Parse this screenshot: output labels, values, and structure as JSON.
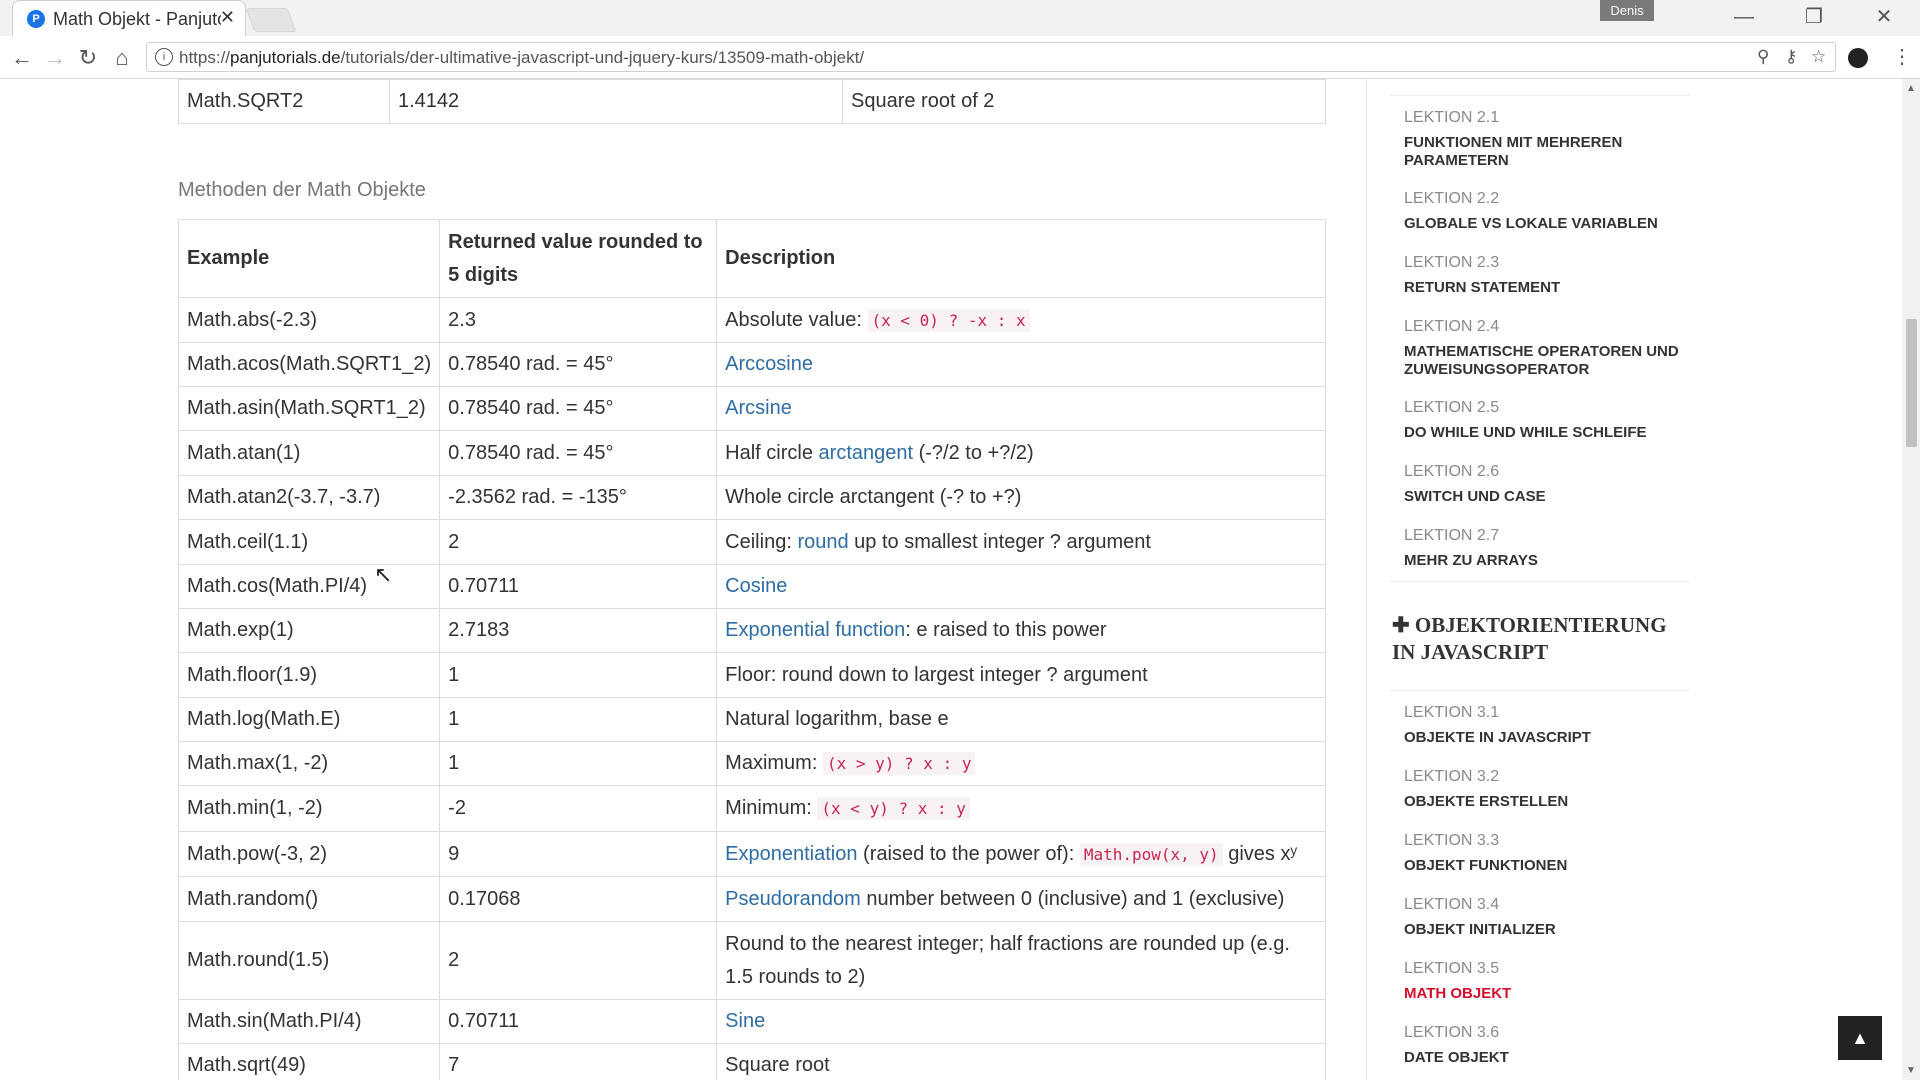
{
  "browser": {
    "tab_title": "Math Objekt - Panjutorials",
    "favicon_letter": "P",
    "close_glyph": "✕",
    "user_badge": "Denis",
    "url_prefix": "https://",
    "url_host": "panjutorials.de",
    "url_path": "/tutorials/der-ultimative-javascript-und-jquery-kurs/13509-math-objekt/"
  },
  "constants_table": {
    "last_row": [
      "Math.SQRT2",
      "1.4142",
      "Square root of 2"
    ]
  },
  "methods_section_title": "Methoden der Math Objekte",
  "methods_table": {
    "headers": [
      "Example",
      "Returned value rounded to 5 digits",
      "Description"
    ],
    "rows": [
      {
        "example": "Math.abs(-2.3)",
        "value": "2.3",
        "pre": "Absolute value: ",
        "link": "",
        "post": "",
        "code": "(x < 0) ? -x : x",
        "after": ""
      },
      {
        "example": "Math.acos(Math.SQRT1_2)",
        "value": "0.78540 rad. = 45°",
        "pre": "",
        "link": "Arccosine",
        "post": "",
        "code": "",
        "after": ""
      },
      {
        "example": "Math.asin(Math.SQRT1_2)",
        "value": "0.78540 rad. = 45°",
        "pre": "",
        "link": "Arcsine",
        "post": "",
        "code": "",
        "after": ""
      },
      {
        "example": "Math.atan(1)",
        "value": "0.78540 rad. = 45°",
        "pre": "Half circle ",
        "link": "arctangent",
        "post": " (-?/2 to +?/2)",
        "code": "",
        "after": ""
      },
      {
        "example": "Math.atan2(-3.7, -3.7)",
        "value": "-2.3562 rad. = -135°",
        "pre": "Whole circle arctangent (-? to +?)",
        "link": "",
        "post": "",
        "code": "",
        "after": ""
      },
      {
        "example": "Math.ceil(1.1)",
        "value": "2",
        "pre": "Ceiling: ",
        "link": "round",
        "post": " up to smallest integer ? argument",
        "code": "",
        "after": ""
      },
      {
        "example": "Math.cos(Math.PI/4)",
        "value": "0.70711",
        "pre": "",
        "link": "Cosine",
        "post": "",
        "code": "",
        "after": ""
      },
      {
        "example": "Math.exp(1)",
        "value": "2.7183",
        "pre": "",
        "link": "Exponential function",
        "post": ": e raised to this power",
        "code": "",
        "after": ""
      },
      {
        "example": "Math.floor(1.9)",
        "value": "1",
        "pre": "Floor: round down to largest integer ? argument",
        "link": "",
        "post": "",
        "code": "",
        "after": ""
      },
      {
        "example": "Math.log(Math.E)",
        "value": "1",
        "pre": "Natural logarithm, base e",
        "link": "",
        "post": "",
        "code": "",
        "after": ""
      },
      {
        "example": "Math.max(1, -2)",
        "value": "1",
        "pre": "Maximum: ",
        "link": "",
        "post": "",
        "code": "(x > y) ? x : y",
        "after": ""
      },
      {
        "example": "Math.min(1, -2)",
        "value": "-2",
        "pre": "Minimum: ",
        "link": "",
        "post": "",
        "code": "(x < y) ? x : y",
        "after": ""
      },
      {
        "example": "Math.pow(-3, 2)",
        "value": "9",
        "pre": "",
        "link": "Exponentiation",
        "post": " (raised to the power of): ",
        "code": "Math.pow(x, y)",
        "after": " gives xʸ"
      },
      {
        "example": "Math.random()",
        "value": "0.17068",
        "pre": "",
        "link": "Pseudorandom",
        "post": " number between 0 (inclusive) and 1 (exclusive)",
        "code": "",
        "after": ""
      },
      {
        "example": "Math.round(1.5)",
        "value": "2",
        "pre": "Round to the nearest integer; half fractions are rounded up (e.g. 1.5 rounds to 2)",
        "link": "",
        "post": "",
        "code": "",
        "after": ""
      },
      {
        "example": "Math.sin(Math.PI/4)",
        "value": "0.70711",
        "pre": "",
        "link": "Sine",
        "post": "",
        "code": "",
        "after": ""
      },
      {
        "example": "Math.sqrt(49)",
        "value": "7",
        "pre": "Square root",
        "link": "",
        "post": "",
        "code": "",
        "after": ""
      }
    ]
  },
  "sidebar": {
    "lessons_a": [
      {
        "num": "LEKTION 2.1",
        "title": "FUNKTIONEN MIT MEHREREN PARAMETERN"
      },
      {
        "num": "LEKTION 2.2",
        "title": "GLOBALE VS LOKALE VARIABLEN"
      },
      {
        "num": "LEKTION 2.3",
        "title": "RETURN STATEMENT"
      },
      {
        "num": "LEKTION 2.4",
        "title": "MATHEMATISCHE OPERATOREN UND ZUWEISUNGSOPERATOR"
      },
      {
        "num": "LEKTION 2.5",
        "title": "DO WHILE UND WHILE SCHLEIFE"
      },
      {
        "num": "LEKTION 2.6",
        "title": "SWITCH UND CASE"
      },
      {
        "num": "LEKTION 2.7",
        "title": "MEHR ZU ARRAYS"
      }
    ],
    "section_heading": "OBJEKTORIENTIERUNG IN JAVASCRIPT",
    "lessons_b": [
      {
        "num": "LEKTION 3.1",
        "title": "OBJEKTE IN JAVASCRIPT"
      },
      {
        "num": "LEKTION 3.2",
        "title": "OBJEKTE ERSTELLEN"
      },
      {
        "num": "LEKTION 3.3",
        "title": "OBJEKT FUNKTIONEN"
      },
      {
        "num": "LEKTION 3.4",
        "title": "OBJEKT INITIALIZER"
      },
      {
        "num": "LEKTION 3.5",
        "title": "MATH OBJEKT",
        "active": true
      },
      {
        "num": "LEKTION 3.6",
        "title": "DATE OBJEKT"
      }
    ]
  },
  "colors": {
    "link": "#2e6da4",
    "active_lesson": "#d0102c",
    "code": "#c7254e"
  }
}
